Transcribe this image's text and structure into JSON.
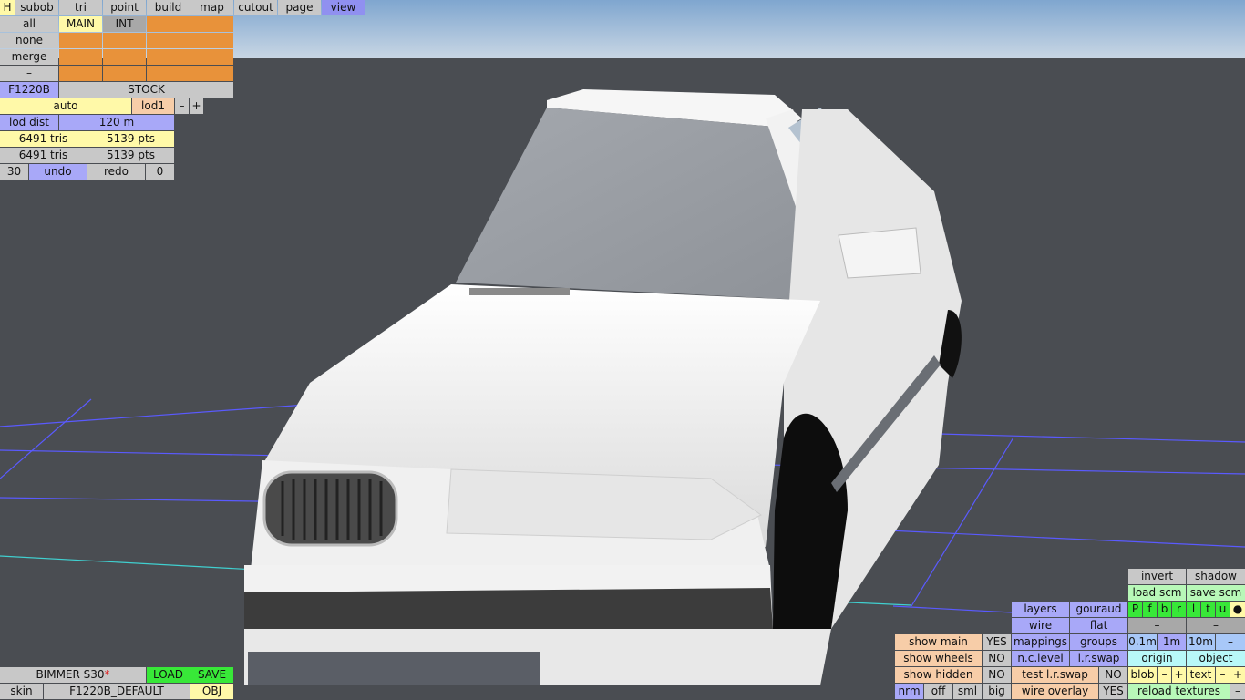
{
  "menu": {
    "items": [
      "H",
      "subob",
      "tri",
      "point",
      "build",
      "map",
      "cutout",
      "page",
      "view"
    ]
  },
  "selection": {
    "all": "all",
    "none": "none",
    "merge": "merge",
    "dash": "–",
    "main": "MAIN",
    "int": "INT"
  },
  "model": {
    "code": "F1220B",
    "variant": "STOCK",
    "auto": "auto",
    "lod": "lod1",
    "minus": "–",
    "plus": "+",
    "lod_dist_label": "lod dist",
    "lod_dist_value": "120 m",
    "tris1": "6491 tris",
    "pts1": "5139 pts",
    "tris2": "6491 tris",
    "pts2": "5139 pts",
    "undo_count": "30",
    "undo": "undo",
    "redo": "redo",
    "redo_count": "0"
  },
  "file": {
    "name": "BIMMER S30",
    "modified_mark": "*",
    "load": "LOAD",
    "save": "SAVE",
    "skin_label": "skin",
    "skin_value": "F1220B_DEFAULT",
    "obj": "OBJ"
  },
  "render_panel": {
    "invert": "invert",
    "shadow": "shadow",
    "load_scm": "load scm",
    "save_scm": "save scm",
    "layers": "layers",
    "gouraud": "gouraud",
    "flags": [
      "P",
      "f",
      "b",
      "r",
      "l",
      "t",
      "u",
      "●"
    ],
    "wire": "wire",
    "flat": "flat",
    "dash1": "–",
    "dash2": "–",
    "show_main": "show main",
    "show_main_val": "YES",
    "mappings": "mappings",
    "groups": "groups",
    "s01": "0.1m",
    "s1": "1m",
    "s10": "10m",
    "sdash": "–",
    "show_wheels": "show wheels",
    "show_wheels_val": "NO",
    "nclevel": "n.c.level",
    "lrswap": "l.r.swap",
    "origin": "origin",
    "object": "object",
    "show_hidden": "show hidden",
    "show_hidden_val": "NO",
    "test_lrswap": "test l.r.swap",
    "test_lrswap_val": "NO",
    "blob": "blob",
    "text": "text",
    "nrm": "nrm",
    "off": "off",
    "sml": "sml",
    "big": "big",
    "wire_overlay": "wire overlay",
    "wire_overlay_val": "YES",
    "reload_textures": "reload textures"
  },
  "colors": {
    "sky": "#8fb4d8",
    "ground": "#4a4d52",
    "grid": "#5a5aff",
    "car_body": "#ececec",
    "window": "#9aa0a8"
  }
}
